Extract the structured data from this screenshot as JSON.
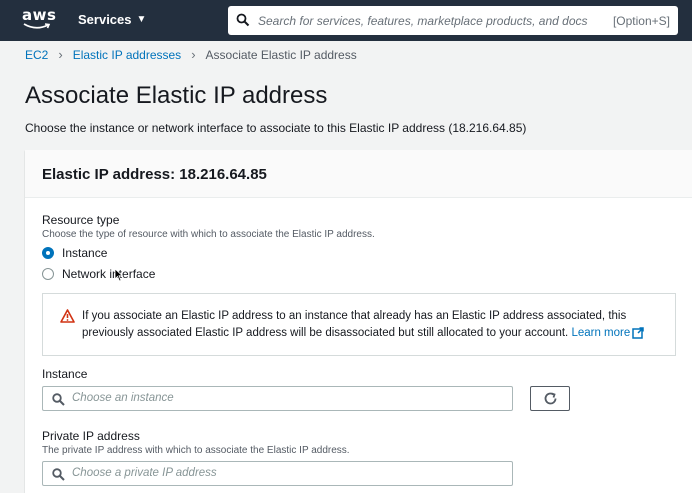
{
  "nav": {
    "logo_text": "aws",
    "services_label": "Services",
    "search_placeholder": "Search for services, features, marketplace products, and docs",
    "search_shortcut": "[Option+S]"
  },
  "breadcrumb": {
    "items": [
      "EC2",
      "Elastic IP addresses"
    ],
    "current": "Associate Elastic IP address"
  },
  "page": {
    "title": "Associate Elastic IP address",
    "description": "Choose the instance or network interface to associate to this Elastic IP address (18.216.64.85)"
  },
  "panel": {
    "title": "Elastic IP address: 18.216.64.85",
    "resource_type": {
      "label": "Resource type",
      "description": "Choose the type of resource with which to associate the Elastic IP address.",
      "options": [
        {
          "label": "Instance",
          "selected": true
        },
        {
          "label": "Network interface",
          "selected": false
        }
      ]
    },
    "alert": {
      "text": "If you associate an Elastic IP address to an instance that already has an Elastic IP address associated, this previously associated Elastic IP address will be disassociated but still allocated to your account.",
      "link": "Learn more"
    },
    "instance": {
      "label": "Instance",
      "placeholder": "Choose an instance"
    },
    "private_ip": {
      "label": "Private IP address",
      "description": "The private IP address with which to associate the Elastic IP address.",
      "placeholder": "Choose a private IP address"
    }
  },
  "colors": {
    "nav_bg": "#232f3e",
    "link": "#0073bb",
    "warning": "#d13212",
    "logo_smile": "#ff9900"
  }
}
